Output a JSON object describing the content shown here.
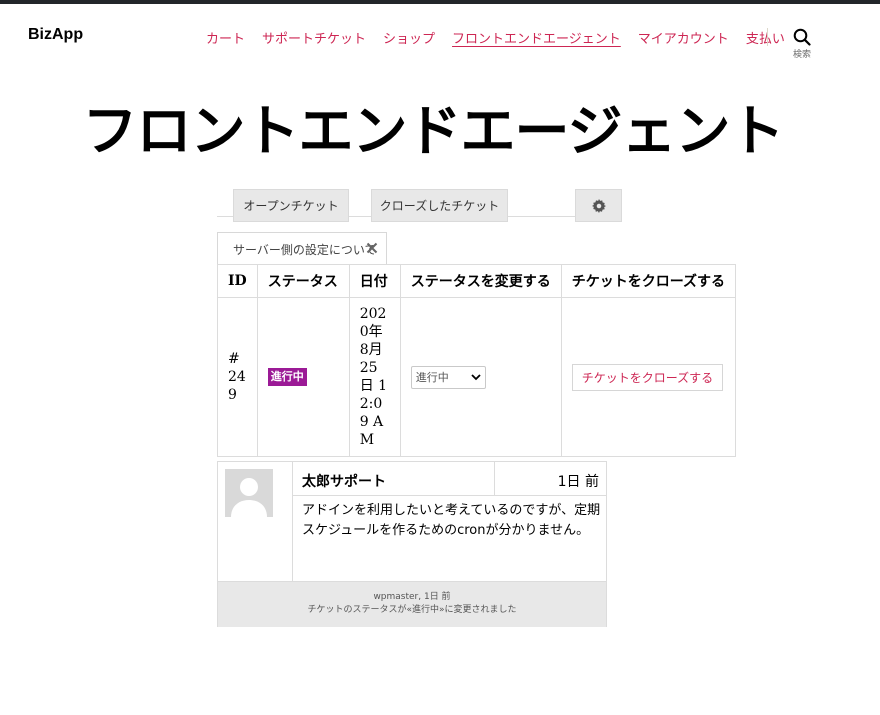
{
  "site": {
    "title": "BizApp"
  },
  "nav": {
    "items": [
      {
        "label": "カート"
      },
      {
        "label": "サポートチケット"
      },
      {
        "label": "ショップ"
      },
      {
        "label": "フロントエンドエージェント"
      },
      {
        "label": "マイアカウント"
      },
      {
        "label": "支払い"
      }
    ],
    "search_label": "検索"
  },
  "page": {
    "title": "フロントエンドエージェント"
  },
  "tabs": {
    "open": "オープンチケット",
    "closed": "クローズしたチケット"
  },
  "notice": {
    "text": "サーバー側の設定について"
  },
  "table": {
    "headers": [
      "ID",
      "ステータス",
      "日付",
      "ステータスを変更する",
      "チケットをクローズする"
    ],
    "row": {
      "id": "#249",
      "status": "進行中",
      "date": "2020年8月25日 12:09 AM",
      "status_select": "進行中",
      "close_button": "チケットをクローズする"
    }
  },
  "reply": {
    "author": "太郎サポート",
    "time": "1日 前",
    "message": "アドインを利用したいと考えているのですが、定期スケジュールを作るためのcronが分かりません。",
    "log_line1": "wpmaster, 1日 前",
    "log_line2": "チケットのステータスが«進行中»に変更されました"
  },
  "colors": {
    "accent": "#cd2653",
    "badge": "#9b1a96"
  },
  "icons": {
    "search": "search-icon",
    "gear": "gear-icon",
    "close": "close-icon",
    "dropdown": "chevron-down-icon",
    "avatar": "user-placeholder-icon"
  }
}
